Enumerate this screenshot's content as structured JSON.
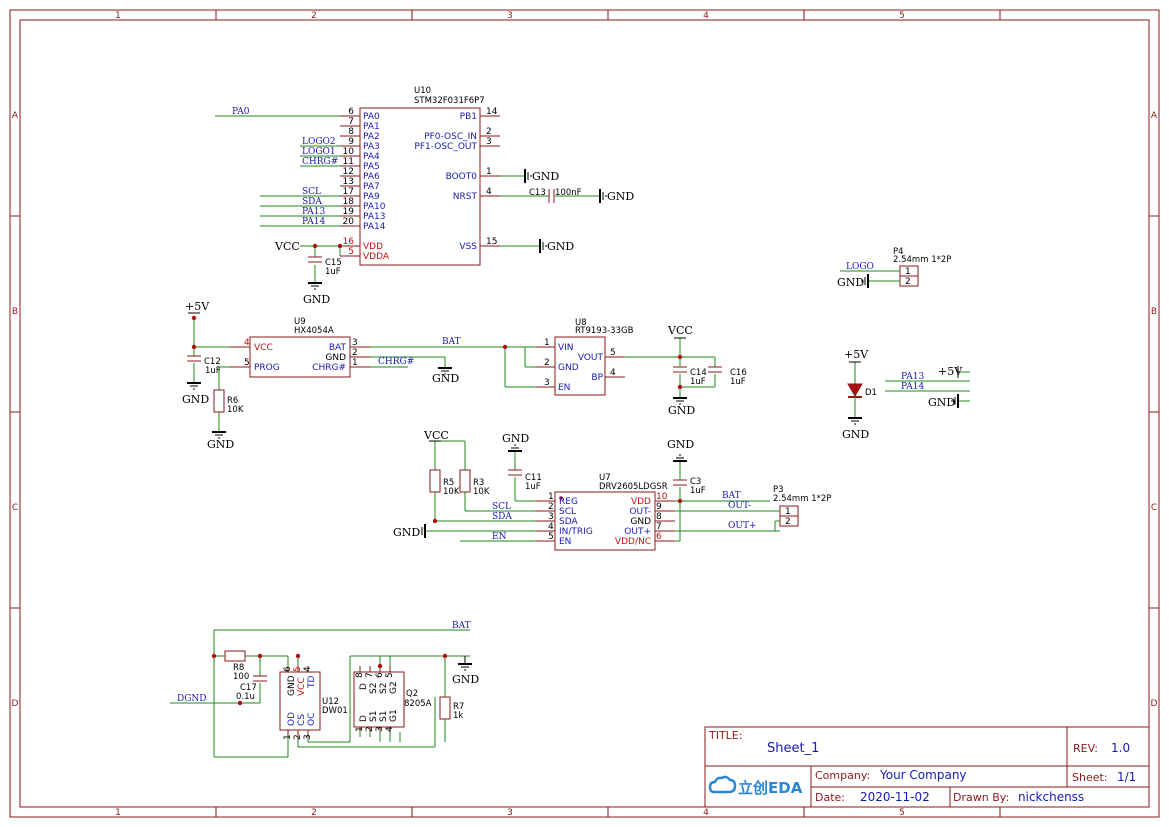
{
  "ruler": {
    "cols": [
      "1",
      "2",
      "3",
      "4",
      "5"
    ],
    "rows": [
      "A",
      "B",
      "C",
      "D"
    ]
  },
  "title_block": {
    "title_label": "TITLE:",
    "title": "Sheet_1",
    "rev_label": "REV:",
    "rev": "1.0",
    "company_label": "Company:",
    "company": "Your Company",
    "sheet_label": "Sheet:",
    "sheet": "1/1",
    "date_label": "Date:",
    "date": "2020-11-02",
    "drawn_label": "Drawn By:",
    "drawn_by": "nickchenss",
    "logo": "立创EDA"
  },
  "u10": {
    "ref": "U10",
    "value": "STM32F031F6P7",
    "left": [
      "PA0",
      "PA1",
      "PA2",
      "PA3",
      "PA4",
      "PA5",
      "PA6",
      "PA7",
      "PA9",
      "PA10",
      "PA13",
      "PA14"
    ],
    "left_nums": [
      "6",
      "7",
      "8",
      "9",
      "10",
      "11",
      "12",
      "13",
      "17",
      "18",
      "19",
      "20"
    ],
    "vdd": "VDD",
    "vdd_num": "16",
    "vdda": "VDDA",
    "vdda_num": "5",
    "pb1": "PB1",
    "pb1_num": "14",
    "pf0": "PF0-OSC_IN",
    "pf0_num": "2",
    "pf1": "PF1-OSC_OUT",
    "pf1_num": "3",
    "boot0": "BOOT0",
    "boot0_num": "1",
    "nrst": "NRST",
    "nrst_num": "4",
    "vss": "VSS",
    "vss_num": "15",
    "nets": [
      "PA0",
      "LOGO2",
      "LOGO1",
      "CHRG#",
      "SCL",
      "SDA",
      "PA13",
      "PA14"
    ]
  },
  "c13": {
    "ref": "C13",
    "value": "100nF"
  },
  "c15": {
    "ref": "C15",
    "value": "1uF"
  },
  "u9": {
    "ref": "U9",
    "value": "HX4054A",
    "vcc": "VCC",
    "prog": "PROG",
    "bat": "BAT",
    "gnd": "GND",
    "chrg": "CHRG#",
    "n_vcc": "4",
    "n_prog": "5",
    "n_bat": "3",
    "n_gnd": "2",
    "n_chrg": "1"
  },
  "c12": {
    "ref": "C12",
    "value": "1uF"
  },
  "r6": {
    "ref": "R6",
    "value": "10K"
  },
  "u8": {
    "ref": "U8",
    "value": "RT9193-33GB",
    "vin": "VIN",
    "gnd": "GND",
    "en": "EN",
    "vout": "VOUT",
    "bp": "BP",
    "n_vin": "1",
    "n_gnd": "2",
    "n_en": "3",
    "n_vout": "5",
    "n_bp": "4"
  },
  "c14": {
    "ref": "C14",
    "value": "1uF"
  },
  "c16": {
    "ref": "C16",
    "value": "1uF"
  },
  "p4": {
    "ref": "P4",
    "value": "2.54mm 1*2P",
    "pins": [
      "1",
      "2"
    ]
  },
  "d1": {
    "ref": "D1"
  },
  "u7": {
    "ref": "U7",
    "value": "DRV2605LDGSR",
    "left": [
      "REG",
      "SCL",
      "SDA",
      "IN/TRIG",
      "EN"
    ],
    "left_nums": [
      "1",
      "2",
      "3",
      "4",
      "5"
    ],
    "right": [
      "VDD",
      "OUT-",
      "GND",
      "OUT+",
      "VDD/NC"
    ],
    "right_nums": [
      "10",
      "9",
      "8",
      "7",
      "6"
    ]
  },
  "r5": {
    "ref": "R5",
    "value": "10K"
  },
  "r3": {
    "ref": "R3",
    "value": "10K"
  },
  "c11": {
    "ref": "C11",
    "value": "1uF"
  },
  "c3": {
    "ref": "C3",
    "value": "1uF"
  },
  "p3": {
    "ref": "P3",
    "value": "2.54mm 1*2P",
    "pins": [
      "1",
      "2"
    ]
  },
  "r8": {
    "ref": "R8",
    "value": "100"
  },
  "c17": {
    "ref": "C17",
    "value": "0.1u"
  },
  "u12": {
    "ref": "U12",
    "value": "DW01",
    "top": [
      "GND",
      "VCC",
      "TD"
    ],
    "bottom": [
      "OD",
      "CS",
      "OC"
    ],
    "top_nums": [
      "6",
      "5",
      "4"
    ],
    "bottom_nums": [
      "1",
      "2",
      "3"
    ]
  },
  "q2": {
    "ref": "Q2",
    "value": "8205A",
    "top": [
      "D",
      "S2",
      "S2",
      "G2"
    ],
    "bottom": [
      "D",
      "S1",
      "S1",
      "G1"
    ],
    "top_nums": [
      "8",
      "7",
      "6",
      "5"
    ],
    "bottom_nums": [
      "1",
      "2",
      "3",
      "4"
    ]
  },
  "r7": {
    "ref": "R7",
    "value": "1k"
  },
  "nets": {
    "vcc": "VCC",
    "gnd": "GND",
    "p5v": "+5V",
    "bat": "BAT",
    "chrg": "CHRG#",
    "logo": "LOGO",
    "pa13": "PA13",
    "pa14": "PA14",
    "scl": "SCL",
    "sda": "SDA",
    "en": "EN",
    "outm": "OUT-",
    "outp": "OUT+",
    "dgnd": "DGND"
  }
}
